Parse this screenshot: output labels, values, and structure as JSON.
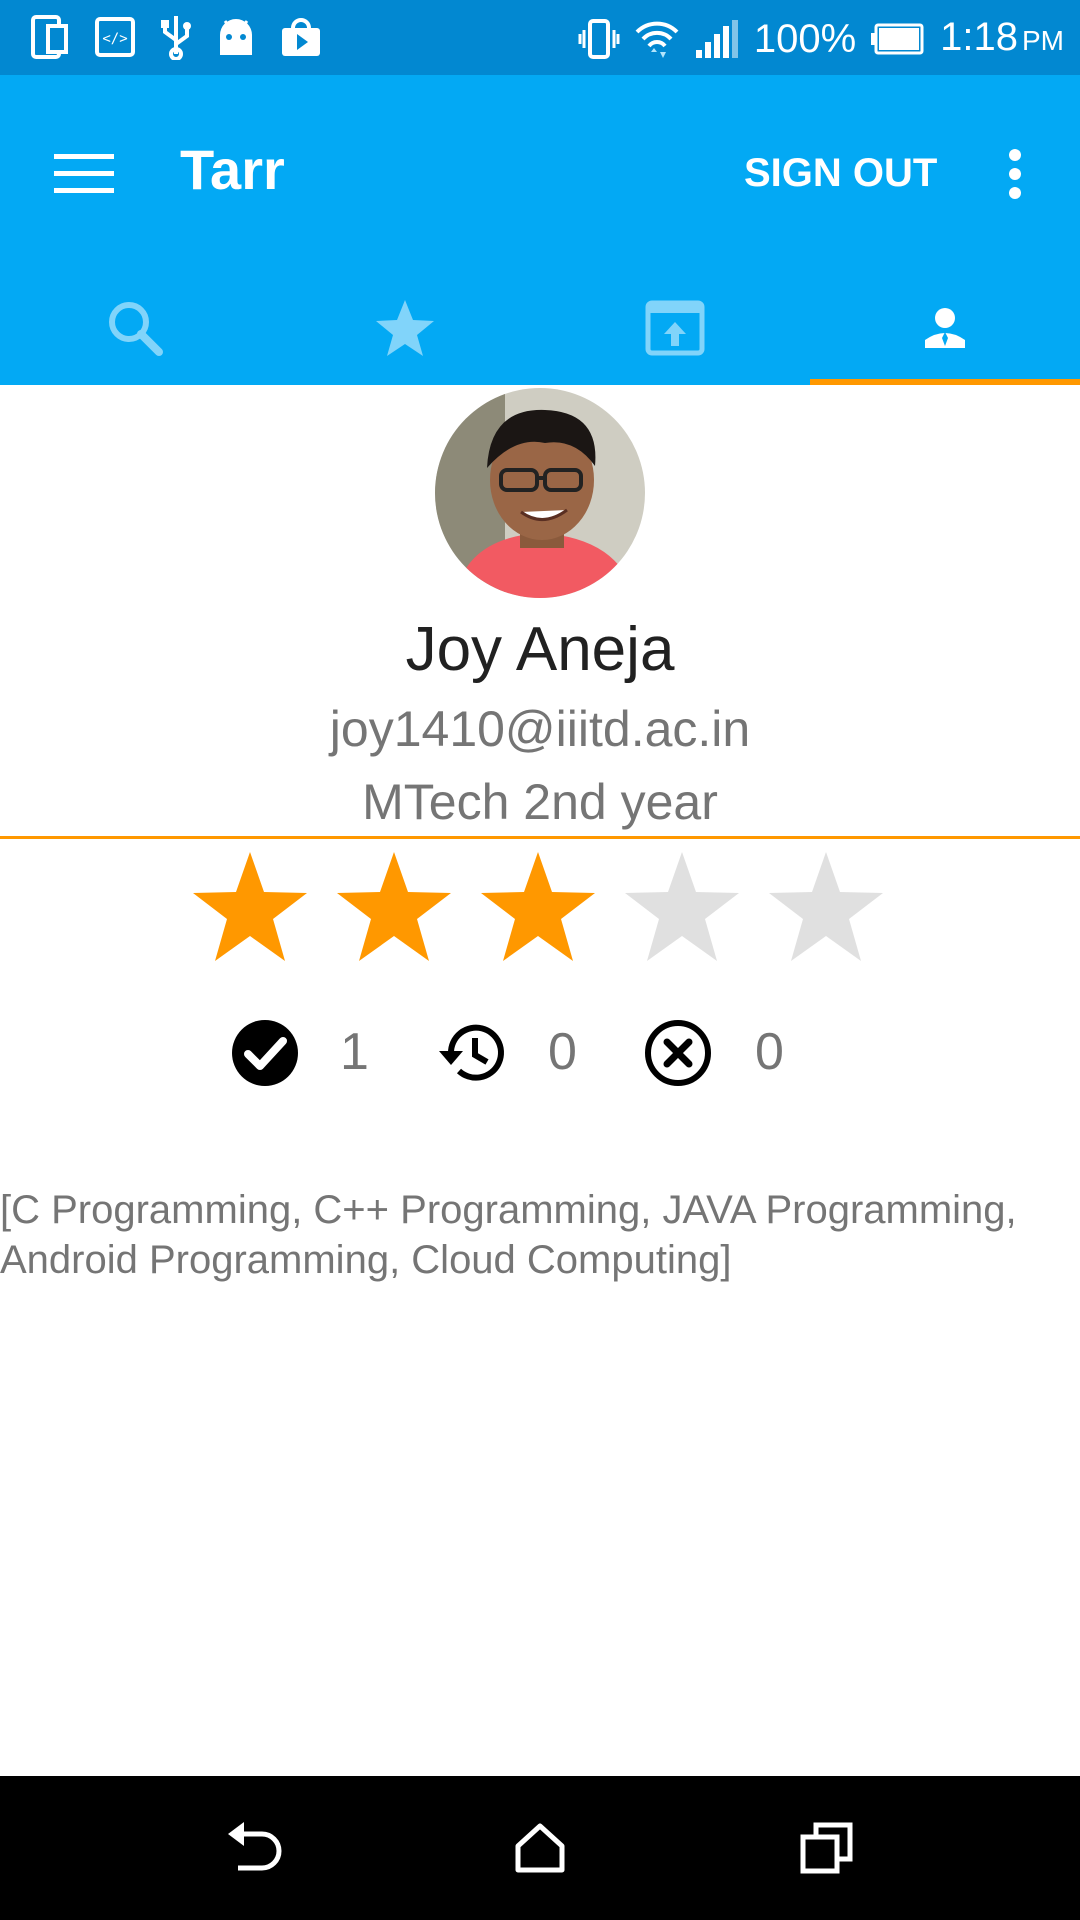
{
  "status_bar": {
    "battery": "100%",
    "time": "1:18",
    "ampm": "PM",
    "icons": [
      "phone-screen-icon",
      "code-icon",
      "usb-icon",
      "android-icon",
      "play-store-icon",
      "vibrate-icon",
      "wifi-icon",
      "signal-icon",
      "battery-icon"
    ]
  },
  "app_bar": {
    "title": "Tarr",
    "sign_out": "SIGN OUT",
    "tabs": [
      "search-icon",
      "star-icon",
      "share-screen-icon",
      "profile-icon"
    ],
    "active_tab": 3
  },
  "profile": {
    "name": "Joy Aneja",
    "email": "joy1410@iiitd.ac.in",
    "year": "MTech 2nd year",
    "rating": 3,
    "rating_max": 5
  },
  "stats": {
    "completed": "1",
    "pending": "0",
    "rejected": "0"
  },
  "skills": "[C Programming, C++ Programming, JAVA Programming, Android Programming, Cloud Computing]",
  "colors": {
    "status_bar": "#0288d1",
    "app_bar": "#03a9f4",
    "accent": "#ff9800",
    "star_empty": "#e0e0e0",
    "tab_icon": "#81d4fa"
  },
  "nav_bar": {
    "icons": [
      "back-icon",
      "home-icon",
      "recents-icon"
    ]
  }
}
